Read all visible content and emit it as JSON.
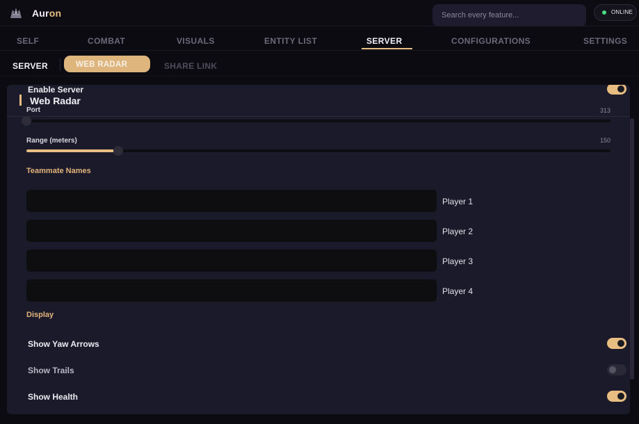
{
  "app": {
    "name_main": "Aur",
    "name_accent": "on",
    "logo_icon": "wolf-logo-icon"
  },
  "search": {
    "placeholder": "Search every feature..."
  },
  "status": {
    "label": "ONLINE",
    "color": "#4ade80"
  },
  "nav": {
    "tabs": [
      "SELF",
      "COMBAT",
      "VISUALS",
      "ENTITY LIST",
      "SERVER",
      "CONFIGURATIONS",
      "SETTINGS"
    ],
    "active": "SERVER"
  },
  "subnav": {
    "tabs": [
      "SERVER",
      "WEB RADAR",
      "SHARE LINK"
    ],
    "active": "WEB RADAR"
  },
  "panel": {
    "enable_label": "Enable Server",
    "title": "Web Radar",
    "enable_on": true,
    "port": {
      "label": "Port",
      "value": "313",
      "fraction": 0.0
    },
    "range": {
      "label": "Range (meters)",
      "value": "150",
      "fraction": 0.157
    },
    "teammates": {
      "title": "Teammate Names",
      "players": [
        {
          "value": "",
          "label": "Player 1"
        },
        {
          "value": "",
          "label": "Player 2"
        },
        {
          "value": "",
          "label": "Player 3"
        },
        {
          "value": "",
          "label": "Player 4"
        }
      ]
    },
    "display": {
      "title": "Display",
      "options": [
        {
          "label": "Show Yaw Arrows",
          "on": true
        },
        {
          "label": "Show Trails",
          "on": false
        },
        {
          "label": "Show Health",
          "on": true
        }
      ]
    }
  },
  "colors": {
    "accent": "#e8bd82",
    "background": "#0c0b12",
    "panel": "#1b1a2a"
  }
}
